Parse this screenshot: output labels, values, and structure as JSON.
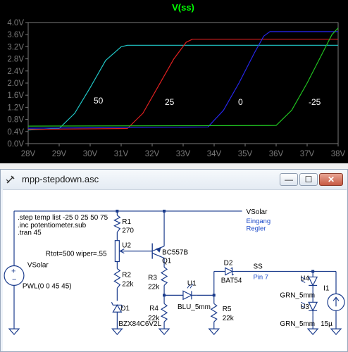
{
  "plot": {
    "title": "V(ss)",
    "title_color": "#00ff00",
    "background": "#000000",
    "axis_color": "#7a7a7a",
    "grid": false
  },
  "chart_data": {
    "type": "line",
    "title": "V(ss)",
    "xlabel": "",
    "ylabel": "",
    "xlim": [
      28,
      38
    ],
    "ylim": [
      0.0,
      4.0
    ],
    "x_ticks": [
      "28V",
      "29V",
      "30V",
      "31V",
      "32V",
      "33V",
      "34V",
      "35V",
      "36V",
      "37V",
      "38V"
    ],
    "y_ticks": [
      "0.0V",
      "0.4V",
      "0.8V",
      "1.2V",
      "1.6V",
      "2.0V",
      "2.4V",
      "2.8V",
      "3.2V",
      "3.6V",
      "4.0V"
    ],
    "series": [
      {
        "name": "50",
        "color": "#20c8c8",
        "x": [
          28.0,
          29.0,
          29.5,
          30.0,
          30.5,
          31.0,
          31.2,
          38.0
        ],
        "y": [
          0.45,
          0.5,
          1.0,
          1.85,
          2.75,
          3.2,
          3.25,
          3.25
        ]
      },
      {
        "name": "25",
        "color": "#e02020",
        "x": [
          28.0,
          31.2,
          31.7,
          32.2,
          32.7,
          33.1,
          33.3,
          38.0
        ],
        "y": [
          0.47,
          0.5,
          1.0,
          1.9,
          2.8,
          3.35,
          3.45,
          3.45
        ]
      },
      {
        "name": "0",
        "color": "#2525e8",
        "x": [
          28.0,
          33.8,
          34.3,
          34.8,
          35.3,
          35.6,
          35.8,
          38.0
        ],
        "y": [
          0.51,
          0.55,
          1.1,
          2.0,
          3.0,
          3.55,
          3.7,
          3.7
        ]
      },
      {
        "name": "-25",
        "color": "#20c020",
        "x": [
          28.0,
          36.0,
          36.5,
          37.0,
          37.5,
          37.8,
          38.0
        ],
        "y": [
          0.58,
          0.6,
          1.1,
          2.0,
          3.0,
          3.6,
          3.82
        ]
      }
    ]
  },
  "window": {
    "title": "mpp-stepdown.asc",
    "min_label": "—",
    "max_label": "☐",
    "close_label": "✕"
  },
  "schematic": {
    "directives": [
      ".step temp list -25 0 25 50 75",
      ".inc potentiometer.sub",
      ".tran 45"
    ],
    "net_vsolar": "VSolar",
    "net_note_1": "Eingang",
    "net_note_2": "Regler",
    "net_ss": "SS",
    "net_ss_note": "Pin 7",
    "vsolar_name": "VSolar",
    "vsolar_value": "PWL(0 0 45 45)",
    "r1_name": "R1",
    "r1_value": "270",
    "u2_name": "U2",
    "u2_value": "Rtot=500 wiper=.55",
    "r2_name": "R2",
    "r2_value": "22k",
    "d1_name": "D1",
    "d1_value": "BZX84C6V2L",
    "q1_value": "BC557B",
    "q1_name": "Q1",
    "r3_name": "R3",
    "r3_value": "22k",
    "r4_name": "R4",
    "r4_value": "22k",
    "u1_name": "U1",
    "u1_value": "BLU_5mm",
    "d2_name": "D2",
    "d2_value": "BAT54",
    "r5_name": "R5",
    "r5_value": "22k",
    "u4_name": "U4",
    "u4_value": "GRN_5mm",
    "u3_name": "U3",
    "u3_value": "GRN_5mm",
    "i1_name": "I1",
    "i1_value": "15µ",
    "wire_color": "#1a3b8c",
    "net_label_color": "#1a48c8"
  }
}
